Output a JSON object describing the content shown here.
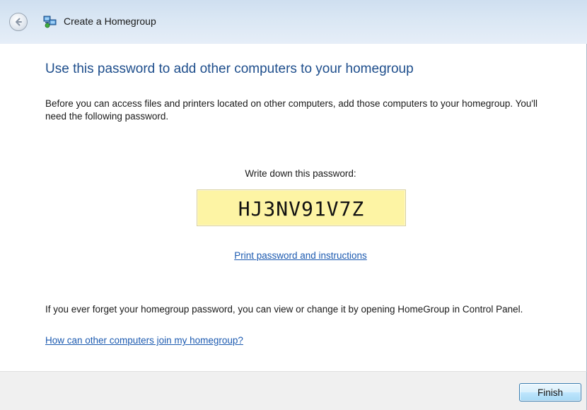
{
  "window": {
    "title": "Create a Homegroup"
  },
  "icons": {
    "back": "back-arrow-icon",
    "app": "homegroup-icon"
  },
  "main": {
    "heading": "Use this password to add other computers to your homegroup",
    "intro": "Before you can access files and printers located on other computers, add those computers to your homegroup. You'll need the following password.",
    "password_label": "Write down this password:",
    "password": "HJ3NV91V7Z",
    "print_link": "Print password and instructions",
    "forget_text": "If you ever forget your homegroup password, you can view or change it by opening HomeGroup in Control Panel.",
    "join_link": "How can other computers join my homegroup?"
  },
  "footer": {
    "finish_label": "Finish"
  },
  "colors": {
    "heading": "#1e4e8c",
    "link": "#1c5ab0",
    "password_bg": "#fdf4a4",
    "footer_bg": "#f0f0f0"
  }
}
